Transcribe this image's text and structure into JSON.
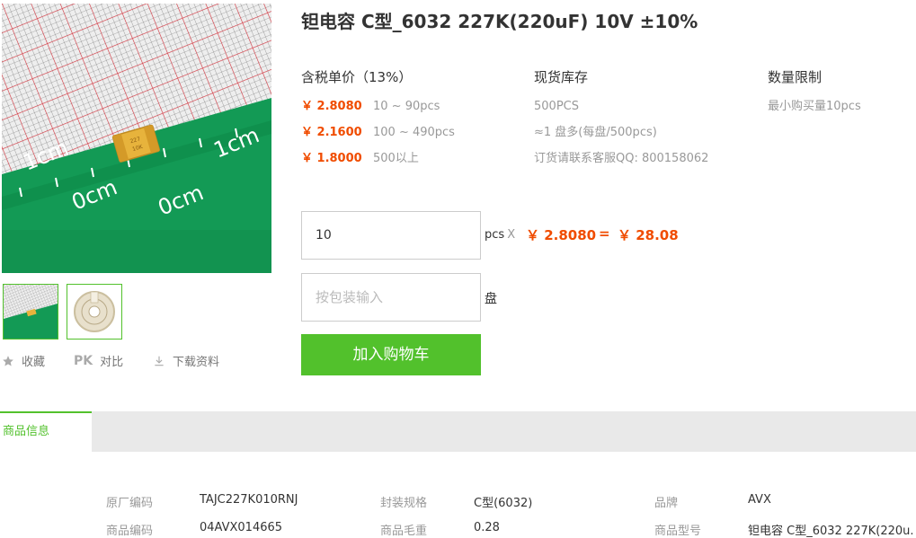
{
  "product": {
    "title": "钽电容 C型_6032 227K(220uF) 10V ±10%"
  },
  "gallery": {
    "main_image": "tantalum-capacitor-on-grid",
    "thumbnails": [
      "tantalum-capacitor-grid-thumb",
      "capacitor-reel-thumb"
    ],
    "ruler_labels": [
      "1cm",
      "1cm",
      "0cm",
      "0cm"
    ]
  },
  "actions": {
    "favorite_label": "收藏",
    "compare_badge": "PK",
    "compare_label": "对比",
    "download_label": "下载资料"
  },
  "pricing": {
    "header": "含税单价（13%）",
    "tiers": [
      {
        "price": "￥ 2.8080",
        "range": "10 ~ 90pcs"
      },
      {
        "price": "￥ 2.1600",
        "range": "100 ~ 490pcs"
      },
      {
        "price": "￥ 1.8000",
        "range": "500以上"
      }
    ]
  },
  "stock": {
    "header": "现货库存",
    "lines": [
      "500PCS",
      "≈1 盘多(每盘/500pcs)",
      "订货请联系客服QQ: 800158062"
    ]
  },
  "limit": {
    "header": "数量限制",
    "lines": [
      "最小购买量10pcs"
    ]
  },
  "purchase": {
    "quantity_value": "10",
    "unit_label": "pcs",
    "times_sign": "X",
    "unit_price": "￥ 2.8080",
    "equals": "=",
    "total": "￥ 28.08",
    "package_placeholder": "按包装输入",
    "package_unit": "盘",
    "cart_button": "加入购物车"
  },
  "tabs": {
    "active": "商品信息"
  },
  "specs": [
    [
      {
        "key": "原厂编码",
        "value": "TAJC227K010RNJ"
      },
      {
        "key": "封装规格",
        "value": "C型(6032)"
      },
      {
        "key": "品牌",
        "value": "AVX"
      }
    ],
    [
      {
        "key": "商品编码",
        "value": "04AVX014665"
      },
      {
        "key": "商品毛重",
        "value": "0.28"
      },
      {
        "key": "商品型号",
        "value": "钽电容 C型_6032 227K(220u."
      }
    ]
  ],
  "colors": {
    "accent_green": "#52c12c",
    "price_orange": "#f04c00"
  }
}
